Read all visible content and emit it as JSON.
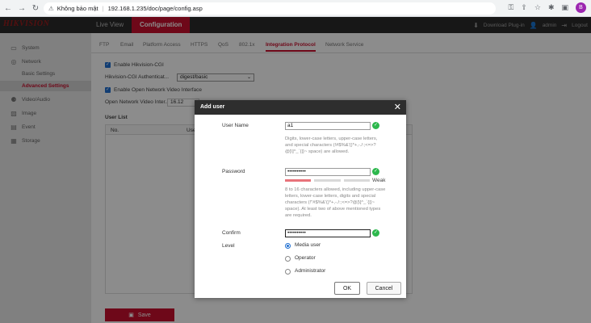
{
  "browser": {
    "security_label": "Không bảo mật",
    "url": "192.168.1.235/doc/page/config.asp",
    "profile_initial": "B"
  },
  "app": {
    "logo_text": "HIKVISION",
    "tabs": [
      "Live View",
      "Configuration"
    ],
    "download_plugin": "Download Plug-in",
    "user": "admin",
    "logout": "Logout"
  },
  "sidebar": {
    "items": [
      {
        "label": "System",
        "icon": "monitor-icon"
      },
      {
        "label": "Network",
        "icon": "globe-icon"
      },
      {
        "label": "Basic Settings",
        "sub": true
      },
      {
        "label": "Advanced Settings",
        "sub": true,
        "active": true
      },
      {
        "label": "Video/Audio",
        "icon": "video-icon"
      },
      {
        "label": "Image",
        "icon": "image-icon"
      },
      {
        "label": "Event",
        "icon": "event-icon"
      },
      {
        "label": "Storage",
        "icon": "storage-icon"
      }
    ]
  },
  "subtabs": [
    "FTP",
    "Email",
    "Platform Access",
    "HTTPS",
    "QoS",
    "802.1x",
    "Integration Protocol",
    "Network Service"
  ],
  "config": {
    "enable_hikvision_cgi": "Enable Hikvision-CGI",
    "cgi_auth_label": "Hikvision-CGI Authenticat...",
    "cgi_auth_value": "digest/basic",
    "enable_onvif": "Enable Open Network Video Interface",
    "onvif_label": "Open Network Video Inter...",
    "onvif_value": "16.12",
    "user_list": "User List",
    "col_no": "No.",
    "col_user": "User",
    "save": "Save"
  },
  "modal": {
    "title": "Add user",
    "close": "✕",
    "username_label": "User Name",
    "username_value": "a1",
    "username_hint": "Digits, lower-case letters, upper-case letters, and special characters (!#$%&'()*+,-./:;<=>?@[\\]^_`{|}~ space) are allowed.",
    "password_label": "Password",
    "password_value": "••••••••••",
    "strength_label": "Weak",
    "password_hint": "8 to 16 characters allowed, including upper-case letters, lower-case letters, digits and special characters (!\"#$%&'()*+,-./:;<=>?@[\\]^_`{|}~ space). At least two of above mentioned types are required.",
    "confirm_label": "Confirm",
    "confirm_value": "••••••••••",
    "level_label": "Level",
    "levels": [
      "Media user",
      "Operator",
      "Administrator"
    ],
    "selected_level": "Media user",
    "ok": "OK",
    "cancel": "Cancel"
  },
  "colors": {
    "accent": "#c8102e",
    "check": "#2db84d",
    "selected": "#1f6fd1"
  }
}
